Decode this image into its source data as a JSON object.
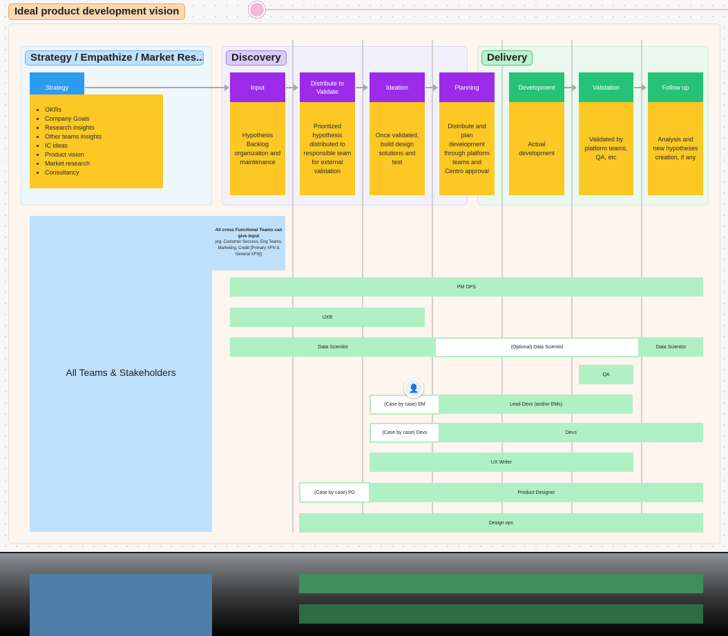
{
  "board_title": "Ideal product development vision",
  "sections": {
    "strategy": "Strategy / Empathize / Market Res...",
    "discovery": "Discovery",
    "delivery": "Delivery"
  },
  "strategy_stage": {
    "head": "Strategy",
    "items": [
      "OKRs",
      "Company Goals",
      "Research insights",
      "Other teams insights",
      "IC ideas",
      "Product vision",
      "Market research",
      "Consultancy"
    ]
  },
  "stages": [
    {
      "head": "Input",
      "note": "Hypothesis Backlog organization and maintenance",
      "color": "#9b2be9"
    },
    {
      "head": "Distribute to Validate",
      "note": "Prioritized hypothesis distributed to responsible team for external validation",
      "color": "#9b2be9"
    },
    {
      "head": "Ideation",
      "note": "Once validated, build design solutions and test",
      "color": "#9b2be9"
    },
    {
      "head": "Planning",
      "note": "Distribute and plan development through platform teams and Centro approval",
      "color": "#9b2be9"
    },
    {
      "head": "Development",
      "note": "Actual development",
      "color": "#26c277"
    },
    {
      "head": "Validation",
      "note": "Validated by platform teams, QA, etc",
      "color": "#26c277"
    },
    {
      "head": "Follow up",
      "note": "Analysis and new hypotheses creation, if any",
      "color": "#26c277"
    }
  ],
  "stakeholders": {
    "label": "All Teams & Stakeholders",
    "note_title": "All cross Functional Teams can give Input",
    "note_body": "(eg. Customer Success, Eng Teams, Marketing, Credit [Primary XFN & General XFN])"
  },
  "lanes": {
    "pm_ops": "PM OPS",
    "uxr": "UXR",
    "data_scientist": "Data Scientist",
    "optional_data_scientist": "(Optional) Data Scientist",
    "data_scientist_end": "Data Scientist",
    "qa": "QA",
    "case_em": "(Case by case) EM",
    "lead_devs": "Lead Devs (and/or EMs)",
    "case_devs": "(Case by case) Devs",
    "devs": "Devs",
    "ux_writer": "UX Writer",
    "case_pd": "(Case by case) PD",
    "product_designer": "Product Designer",
    "design_ops": "Design ops"
  },
  "icons": {
    "pin": "pin-icon",
    "avatar": "avatar-icon"
  }
}
